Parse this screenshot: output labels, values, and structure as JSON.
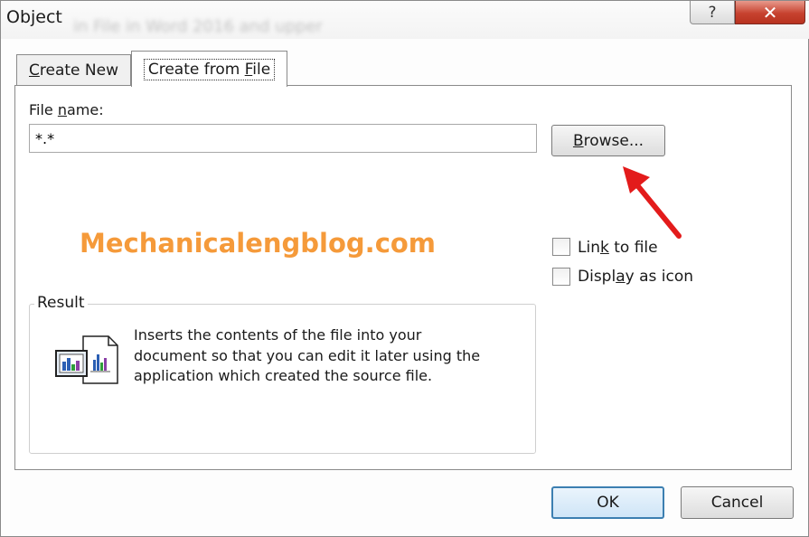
{
  "window": {
    "title": "Object",
    "blurred_background_text": "in File in Word 2016 and upper",
    "help_label": "?",
    "close_label": "✕"
  },
  "tabs": {
    "create_new": {
      "pre": "",
      "key": "C",
      "post": "reate New"
    },
    "create_from_file": {
      "pre": "Create from ",
      "key": "F",
      "post": "ile"
    }
  },
  "file": {
    "label_pre": "File ",
    "label_key": "n",
    "label_post": "ame:",
    "value": "*.*"
  },
  "browse": {
    "pre": "",
    "key": "B",
    "post": "rowse..."
  },
  "watermark": "Mechanicalengblog.com",
  "options": {
    "link": {
      "pre": "Lin",
      "key": "k",
      "post": " to file",
      "checked": false
    },
    "display": {
      "pre": "Displ",
      "key": "a",
      "post": "y as icon",
      "checked": false
    }
  },
  "result": {
    "legend": "Result",
    "description": "Inserts the contents of the file into your document so that you can edit it later using the application which created the source file."
  },
  "buttons": {
    "ok": "OK",
    "cancel": "Cancel"
  },
  "colors": {
    "watermark": "#f59a3a",
    "arrow": "#e31b1b",
    "close_button": "#c7422f"
  }
}
